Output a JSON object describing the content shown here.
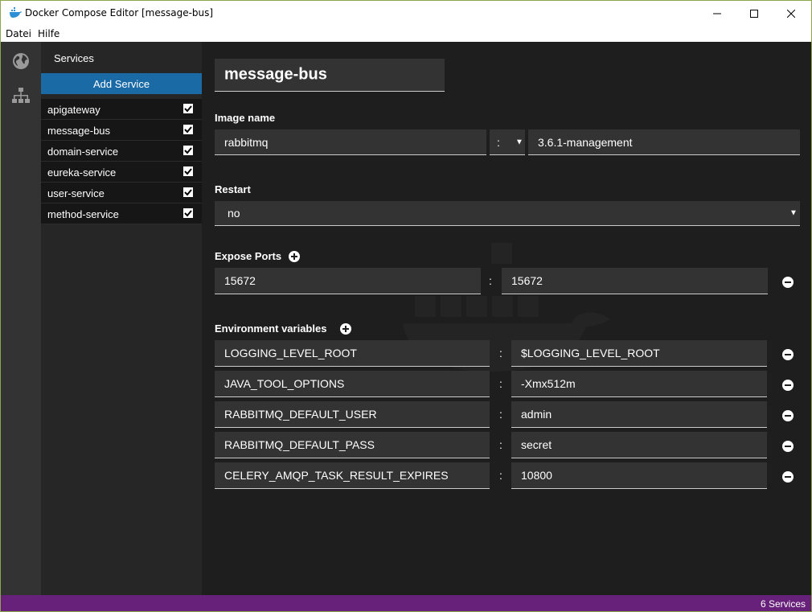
{
  "window": {
    "title": "Docker Compose Editor [message-bus]"
  },
  "menu": {
    "file": "Datei",
    "help": "Hilfe"
  },
  "sidebar": {
    "heading": "Services",
    "add_label": "Add Service",
    "items": [
      {
        "label": "apigateway",
        "checked": true
      },
      {
        "label": "message-bus",
        "checked": true
      },
      {
        "label": "domain-service",
        "checked": true
      },
      {
        "label": "eureka-service",
        "checked": true
      },
      {
        "label": "user-service",
        "checked": true
      },
      {
        "label": "method-service",
        "checked": true
      }
    ]
  },
  "service": {
    "name": "message-bus",
    "image_label": "Image name",
    "image": "rabbitmq",
    "tag_separator": ":",
    "tag": "3.6.1-management",
    "restart_label": "Restart",
    "restart": "no",
    "ports_label": "Expose Ports",
    "ports": [
      {
        "host": "15672",
        "sep": ":",
        "container": "15672"
      }
    ],
    "env_label": "Environment variables",
    "env": [
      {
        "key": "LOGGING_LEVEL_ROOT",
        "sep": ":",
        "value": "$LOGGING_LEVEL_ROOT"
      },
      {
        "key": "JAVA_TOOL_OPTIONS",
        "sep": ":",
        "value": "-Xmx512m"
      },
      {
        "key": "RABBITMQ_DEFAULT_USER",
        "sep": ":",
        "value": "admin"
      },
      {
        "key": "RABBITMQ_DEFAULT_PASS",
        "sep": ":",
        "value": "secret"
      },
      {
        "key": "CELERY_AMQP_TASK_RESULT_EXPIRES",
        "sep": ":",
        "value": "10800"
      }
    ]
  },
  "status": {
    "count_text": "6 Services"
  },
  "colors": {
    "accent": "#1a6aa6",
    "status_bar": "#68217a",
    "background": "#1e1e1e"
  }
}
